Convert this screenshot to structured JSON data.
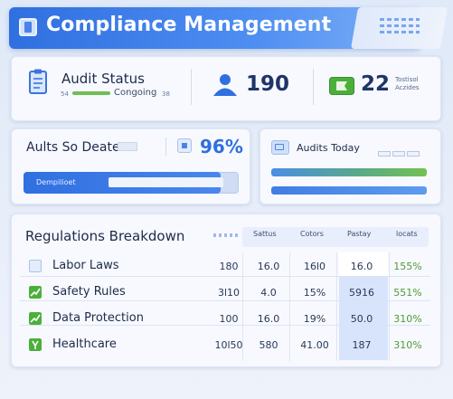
{
  "header": {
    "title": "Compliance Management",
    "app_icon": "app-logo-icon",
    "menu_icon": "menu-icon"
  },
  "stats": {
    "audit_status": {
      "title": "Audit Status",
      "prefix": "54",
      "subtitle": "Congoing",
      "suffix": "38",
      "icon": "clipboard-icon",
      "progress": 0.7
    },
    "people": {
      "value": "190",
      "icon": "person-icon"
    },
    "total": {
      "value": "22",
      "label_line1": "Tostisol",
      "label_line2": "Aczides",
      "icon": "flag-icon"
    }
  },
  "progress_card": {
    "label": "Aults So Deate:",
    "percent": "96%",
    "bar_label": "Dempilioet",
    "fill": 0.96
  },
  "today_card": {
    "label": "Audits Today",
    "bars": [
      0.98,
      0.98
    ]
  },
  "table": {
    "title": "Regulations Breakdown",
    "columns": [
      "Sattus",
      "Cotors",
      "Pastay",
      "locats"
    ],
    "rows": [
      {
        "label": "Labor Laws",
        "icon": "document-icon",
        "c0": "180",
        "c1": "16.0",
        "c2": "16l0",
        "c3": "16.0",
        "c4": "155%"
      },
      {
        "label": "Safety Rules",
        "icon": "chart-up-icon",
        "c0": "3l10",
        "c1": "4.0",
        "c2": "15%",
        "c3": "5916",
        "c4": "551%"
      },
      {
        "label": "Data Protection",
        "icon": "chart-up-icon",
        "c0": "100",
        "c1": "16.0",
        "c2": "19%",
        "c3": "50.0",
        "c4": "310%"
      },
      {
        "label": "Healthcare",
        "icon": "check-shield-icon",
        "c0": "10l50",
        "c1": "580",
        "c2": "41.00",
        "c3": "187",
        "c4": "310%"
      }
    ]
  },
  "colors": {
    "accent": "#2f6fe0",
    "green": "#4f9a33",
    "header_bg": "#3b7ce8"
  }
}
